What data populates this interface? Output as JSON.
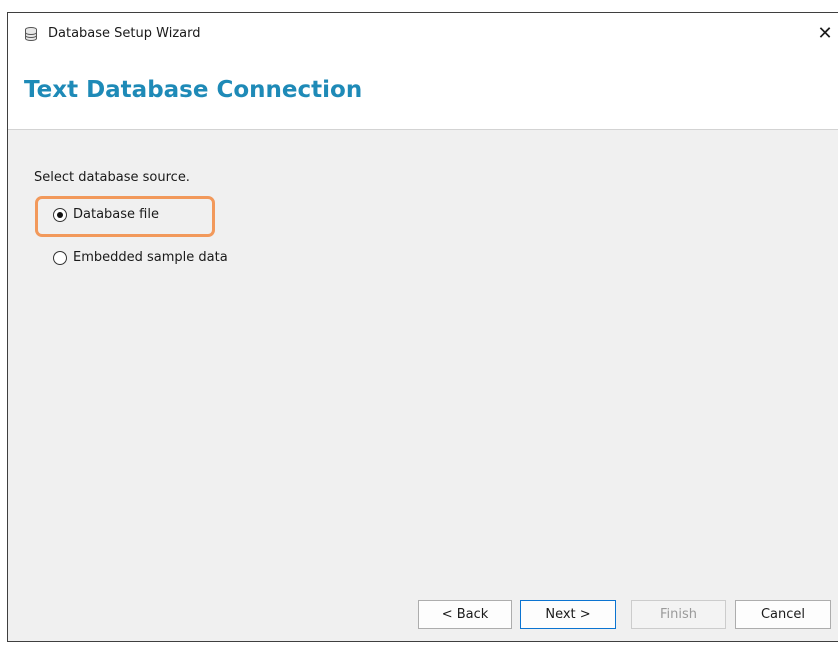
{
  "window": {
    "title": "Database Setup Wizard",
    "close_glyph": "✕",
    "icon": "database-icon"
  },
  "header": {
    "title": "Text Database Connection"
  },
  "main": {
    "prompt": "Select database source.",
    "options": [
      {
        "label": "Database file",
        "selected": true
      },
      {
        "label": "Embedded sample data",
        "selected": false
      }
    ],
    "highlight_color": "#f2995b"
  },
  "footer": {
    "back_label": "< Back",
    "next_label": "Next >",
    "finish_label": "Finish",
    "finish_enabled": false,
    "cancel_label": "Cancel"
  },
  "colors": {
    "title_accent": "#1e8ab7",
    "default_button_border": "#0b74d1"
  }
}
